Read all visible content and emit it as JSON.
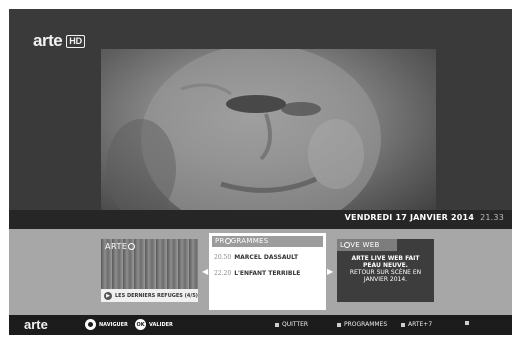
{
  "brand": {
    "name": "arte",
    "badge": "HD"
  },
  "status": {
    "date": "VENDREDI 17 JANVIER 2014",
    "time": "21.33"
  },
  "cards": {
    "arte": {
      "title_prefix": "ARTE",
      "caption": "LES DERNIERS REFUGES (4/5)"
    },
    "programmes": {
      "title_prefix": "PR",
      "title_suffix": "GRAMMES",
      "rows": [
        {
          "time": "20.50",
          "title": "MARCEL DASSAULT"
        },
        {
          "time": "22.20",
          "title": "L'ENFANT TERRIBLE"
        }
      ]
    },
    "web": {
      "title_prefix": "L",
      "title_suffix": "VE WEB",
      "line1": "ARTE LIVE WEB FAIT",
      "line2": "PEAU NEUVE.",
      "line3": "RETOUR SUR SCÈNE EN",
      "line4": "JANVIER 2014."
    }
  },
  "bottom": {
    "logo": "arte",
    "navigate": "NAVIGUER",
    "ok_glyph": "OK",
    "validate": "VALIDER",
    "quit": "QUITTER",
    "programmes": "PROGRAMMES",
    "arte_plus7": "ARTE+7"
  },
  "arrows": {
    "left": "◀",
    "right": "▶"
  },
  "icons": [
    "nav-icon",
    "ok-icon",
    "play-icon",
    "square-bullet-icon"
  ]
}
